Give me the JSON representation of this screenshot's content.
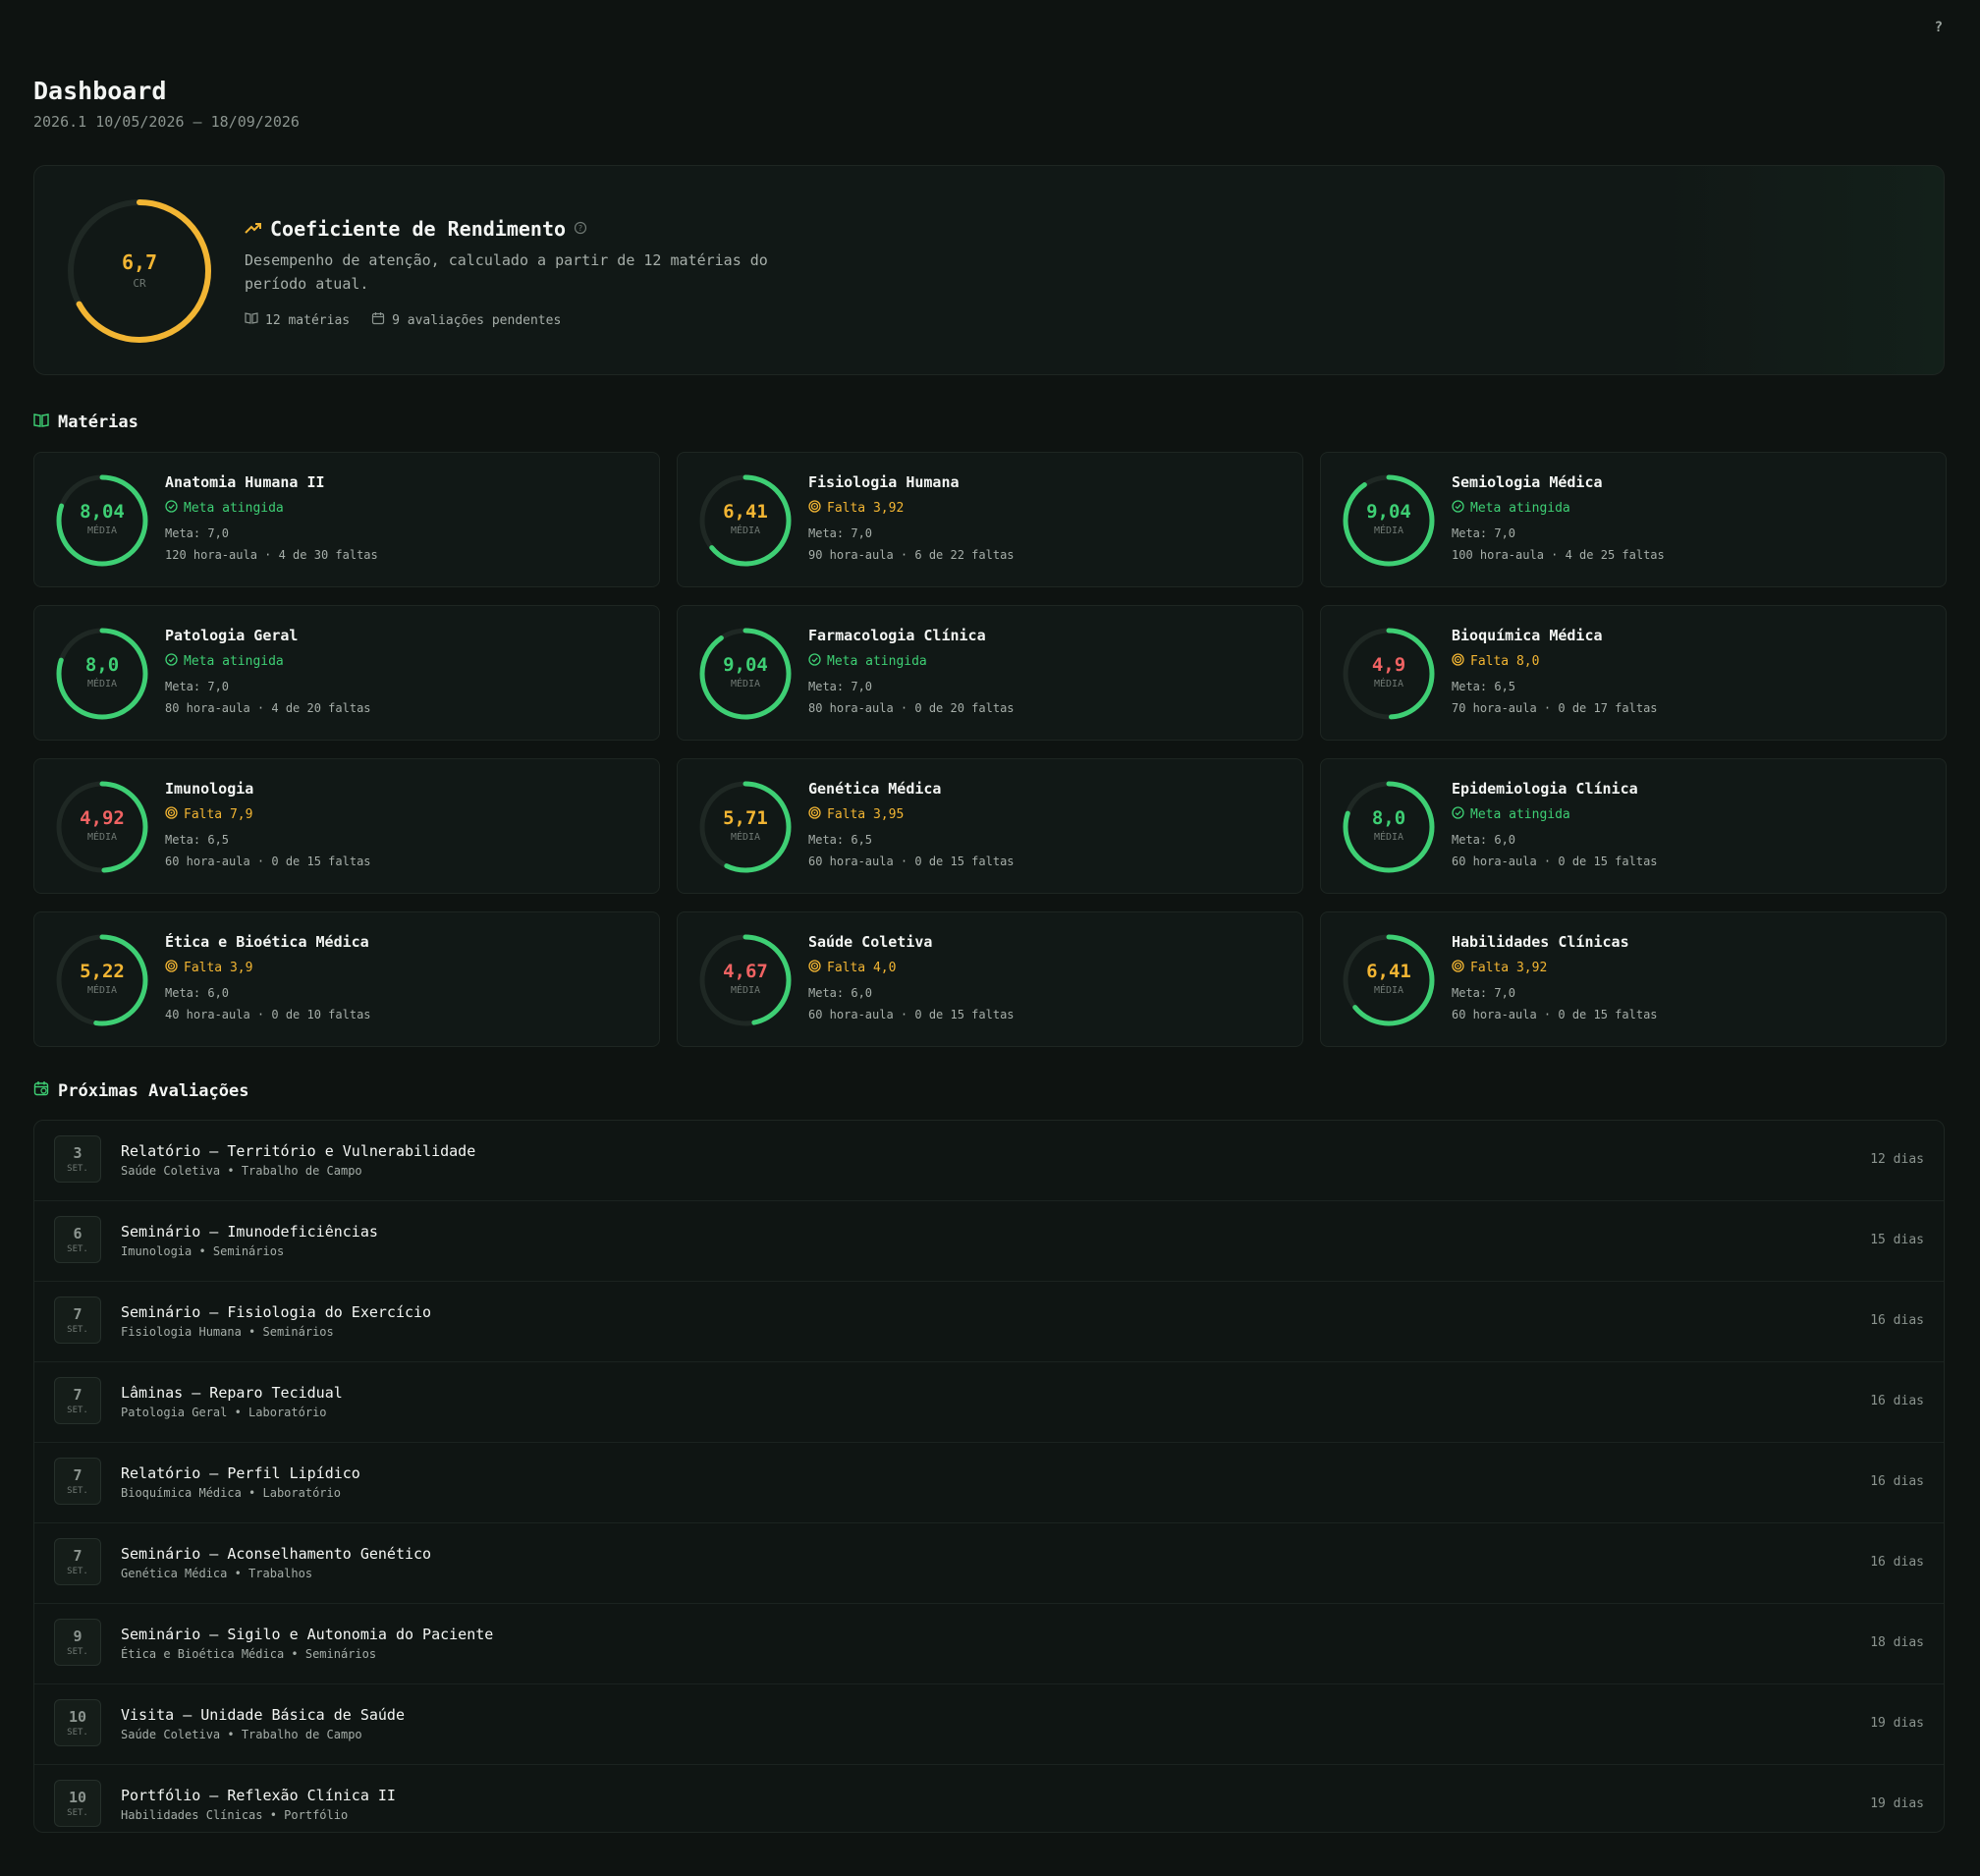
{
  "help_label": "?",
  "header": {
    "title": "Dashboard",
    "subtitle": "2026.1 10/05/2026 – 18/09/2026"
  },
  "colors": {
    "green": "#3ecf74",
    "yellow": "#f2b533",
    "red": "#f06363",
    "track": "#1f2824"
  },
  "cr": {
    "value": "6,7",
    "value_num": 6.7,
    "label": "CR",
    "title": "Coeficiente de Rendimento",
    "description": "Desempenho de atenção, calculado a partir de 12 matérias do período atual.",
    "subjects_count": "12 matérias",
    "pending": "9 avaliações pendentes"
  },
  "subjects_section": {
    "title": "Matérias"
  },
  "subjects": [
    {
      "name": "Anatomia Humana II",
      "avg": "8,04",
      "avg_num": 8.04,
      "avg_label": "MÉDIA",
      "status": "Meta atingida",
      "met": true,
      "meta": "Meta: 7,0",
      "info": "120 hora-aula · 4 de 30 faltas",
      "value_color": "green",
      "ring_color": "green"
    },
    {
      "name": "Fisiologia Humana",
      "avg": "6,41",
      "avg_num": 6.41,
      "avg_label": "MÉDIA",
      "status": "Falta 3,92",
      "met": false,
      "meta": "Meta: 7,0",
      "info": "90 hora-aula · 6 de 22 faltas",
      "value_color": "yellow",
      "ring_color": "green"
    },
    {
      "name": "Semiologia Médica",
      "avg": "9,04",
      "avg_num": 9.04,
      "avg_label": "MÉDIA",
      "status": "Meta atingida",
      "met": true,
      "meta": "Meta: 7,0",
      "info": "100 hora-aula · 4 de 25 faltas",
      "value_color": "green",
      "ring_color": "green"
    },
    {
      "name": "Patologia Geral",
      "avg": "8,0",
      "avg_num": 8.0,
      "avg_label": "MÉDIA",
      "status": "Meta atingida",
      "met": true,
      "meta": "Meta: 7,0",
      "info": "80 hora-aula · 4 de 20 faltas",
      "value_color": "green",
      "ring_color": "green"
    },
    {
      "name": "Farmacologia Clínica",
      "avg": "9,04",
      "avg_num": 9.04,
      "avg_label": "MÉDIA",
      "status": "Meta atingida",
      "met": true,
      "meta": "Meta: 7,0",
      "info": "80 hora-aula · 0 de 20 faltas",
      "value_color": "green",
      "ring_color": "green"
    },
    {
      "name": "Bioquímica Médica",
      "avg": "4,9",
      "avg_num": 4.9,
      "avg_label": "MÉDIA",
      "status": "Falta 8,0",
      "met": false,
      "meta": "Meta: 6,5",
      "info": "70 hora-aula · 0 de 17 faltas",
      "value_color": "red",
      "ring_color": "green"
    },
    {
      "name": "Imunologia",
      "avg": "4,92",
      "avg_num": 4.92,
      "avg_label": "MÉDIA",
      "status": "Falta 7,9",
      "met": false,
      "meta": "Meta: 6,5",
      "info": "60 hora-aula · 0 de 15 faltas",
      "value_color": "red",
      "ring_color": "green"
    },
    {
      "name": "Genética Médica",
      "avg": "5,71",
      "avg_num": 5.71,
      "avg_label": "MÉDIA",
      "status": "Falta 3,95",
      "met": false,
      "meta": "Meta: 6,5",
      "info": "60 hora-aula · 0 de 15 faltas",
      "value_color": "yellow",
      "ring_color": "green"
    },
    {
      "name": "Epidemiologia Clínica",
      "avg": "8,0",
      "avg_num": 8.0,
      "avg_label": "MÉDIA",
      "status": "Meta atingida",
      "met": true,
      "meta": "Meta: 6,0",
      "info": "60 hora-aula · 0 de 15 faltas",
      "value_color": "green",
      "ring_color": "green"
    },
    {
      "name": "Ética e Bioética Médica",
      "avg": "5,22",
      "avg_num": 5.22,
      "avg_label": "MÉDIA",
      "status": "Falta 3,9",
      "met": false,
      "meta": "Meta: 6,0",
      "info": "40 hora-aula · 0 de 10 faltas",
      "value_color": "yellow",
      "ring_color": "green"
    },
    {
      "name": "Saúde Coletiva",
      "avg": "4,67",
      "avg_num": 4.67,
      "avg_label": "MÉDIA",
      "status": "Falta 4,0",
      "met": false,
      "meta": "Meta: 6,0",
      "info": "60 hora-aula · 0 de 15 faltas",
      "value_color": "red",
      "ring_color": "green"
    },
    {
      "name": "Habilidades Clínicas",
      "avg": "6,41",
      "avg_num": 6.41,
      "avg_label": "MÉDIA",
      "status": "Falta 3,92",
      "met": false,
      "meta": "Meta: 7,0",
      "info": "60 hora-aula · 0 de 15 faltas",
      "value_color": "yellow",
      "ring_color": "green"
    }
  ],
  "evaluations_section": {
    "title": "Próximas Avaliações"
  },
  "evaluations": [
    {
      "day": "3",
      "month": "SET.",
      "title": "Relatório — Território e Vulnerabilidade",
      "subtitle": "Saúde Coletiva • Trabalho de Campo",
      "days": "12 dias"
    },
    {
      "day": "6",
      "month": "SET.",
      "title": "Seminário — Imunodeficiências",
      "subtitle": "Imunologia • Seminários",
      "days": "15 dias"
    },
    {
      "day": "7",
      "month": "SET.",
      "title": "Seminário — Fisiologia do Exercício",
      "subtitle": "Fisiologia Humana • Seminários",
      "days": "16 dias"
    },
    {
      "day": "7",
      "month": "SET.",
      "title": "Lâminas — Reparo Tecidual",
      "subtitle": "Patologia Geral • Laboratório",
      "days": "16 dias"
    },
    {
      "day": "7",
      "month": "SET.",
      "title": "Relatório — Perfil Lipídico",
      "subtitle": "Bioquímica Médica • Laboratório",
      "days": "16 dias"
    },
    {
      "day": "7",
      "month": "SET.",
      "title": "Seminário — Aconselhamento Genético",
      "subtitle": "Genética Médica • Trabalhos",
      "days": "16 dias"
    },
    {
      "day": "9",
      "month": "SET.",
      "title": "Seminário — Sigilo e Autonomia do Paciente",
      "subtitle": "Ética e Bioética Médica • Seminários",
      "days": "18 dias"
    },
    {
      "day": "10",
      "month": "SET.",
      "title": "Visita — Unidade Básica de Saúde",
      "subtitle": "Saúde Coletiva • Trabalho de Campo",
      "days": "19 dias"
    },
    {
      "day": "10",
      "month": "SET.",
      "title": "Portfólio — Reflexão Clínica II",
      "subtitle": "Habilidades Clínicas • Portfólio",
      "days": "19 dias"
    }
  ]
}
